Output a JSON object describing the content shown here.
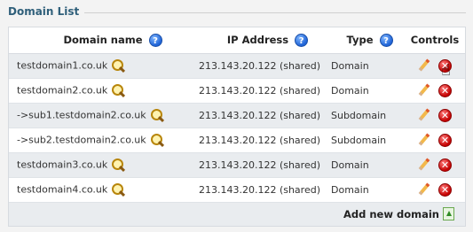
{
  "panel": {
    "title": "Domain List"
  },
  "columns": {
    "domain": "Domain name",
    "ip": "IP Address",
    "type": "Type",
    "controls": "Controls"
  },
  "help_glyph": "?",
  "delete_glyph": "✕",
  "rows": [
    {
      "domain": "testdomain1.co.uk",
      "ip": "213.143.20.122 (shared)",
      "type": "Domain"
    },
    {
      "domain": "testdomain2.co.uk",
      "ip": "213.143.20.122 (shared)",
      "type": "Domain"
    },
    {
      "domain": "->sub1.testdomain2.co.uk",
      "ip": "213.143.20.122 (shared)",
      "type": "Subdomain"
    },
    {
      "domain": "->sub2.testdomain2.co.uk",
      "ip": "213.143.20.122 (shared)",
      "type": "Subdomain"
    },
    {
      "domain": "testdomain3.co.uk",
      "ip": "213.143.20.122 (shared)",
      "type": "Domain"
    },
    {
      "domain": "testdomain4.co.uk",
      "ip": "213.143.20.122 (shared)",
      "type": "Domain"
    }
  ],
  "footer": {
    "add_label": "Add new domain"
  }
}
